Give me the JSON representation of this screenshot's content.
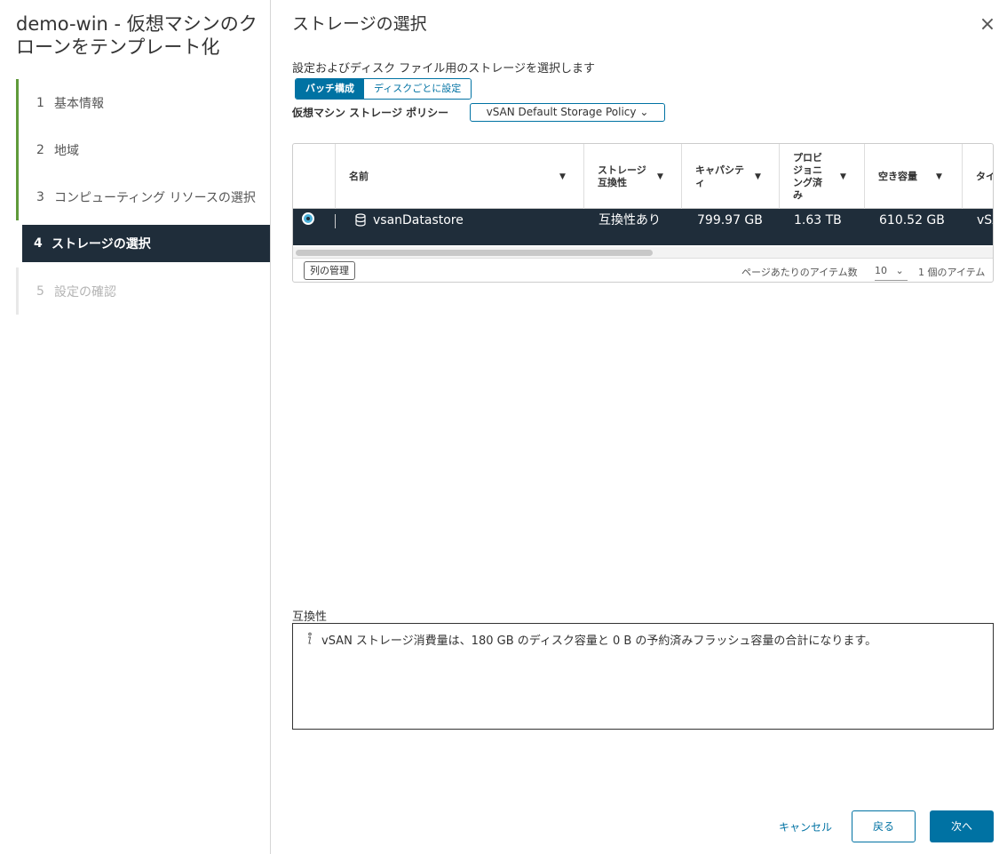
{
  "wizard": {
    "title": "demo-win - 仮想マシンのクローンをテンプレート化",
    "steps": [
      {
        "num": "1",
        "label": "基本情報"
      },
      {
        "num": "2",
        "label": "地域"
      },
      {
        "num": "3",
        "label": "コンピューティング リソースの選択"
      },
      {
        "num": "4",
        "label": "ストレージの選択"
      },
      {
        "num": "5",
        "label": "設定の確認"
      }
    ]
  },
  "page": {
    "title": "ストレージの選択",
    "description": "設定およびディスク ファイル用のストレージを選択します",
    "close_icon": "×"
  },
  "mode": {
    "batch_label": "バッチ構成",
    "per_disk_label": "ディスクごとに設定",
    "active": "batch"
  },
  "policy": {
    "label": "仮想マシン ストレージ ポリシー",
    "value": "vSAN Default Storage Policy",
    "caret": "⌄"
  },
  "table": {
    "columns": [
      "名前",
      "ストレージ 互換性",
      "キャパシティ",
      "プロビジョニング済み",
      "空き容量",
      "タイ"
    ],
    "rows": [
      {
        "name": "vsanDatastore",
        "compatibility": "互換性あり",
        "capacity": "799.97 GB",
        "provisioned": "1.63 TB",
        "free": "610.52 GB",
        "type": "vSA",
        "selected": true
      }
    ],
    "manage_columns": "列の管理",
    "per_page_label": "ページあたりのアイテム数",
    "per_page_value": "10",
    "item_count": "1 個のアイテム"
  },
  "compatibility": {
    "label": "互換性",
    "message": "vSAN ストレージ消費量は、180 GB のディスク容量と 0 B の予約済みフラッシュ容量の合計になります。"
  },
  "actions": {
    "cancel": "キャンセル",
    "back": "戻る",
    "next": "次へ"
  },
  "colors": {
    "accent": "#0072a3",
    "selected_row": "#1f2d3a",
    "step_done": "#5f9a3a"
  }
}
